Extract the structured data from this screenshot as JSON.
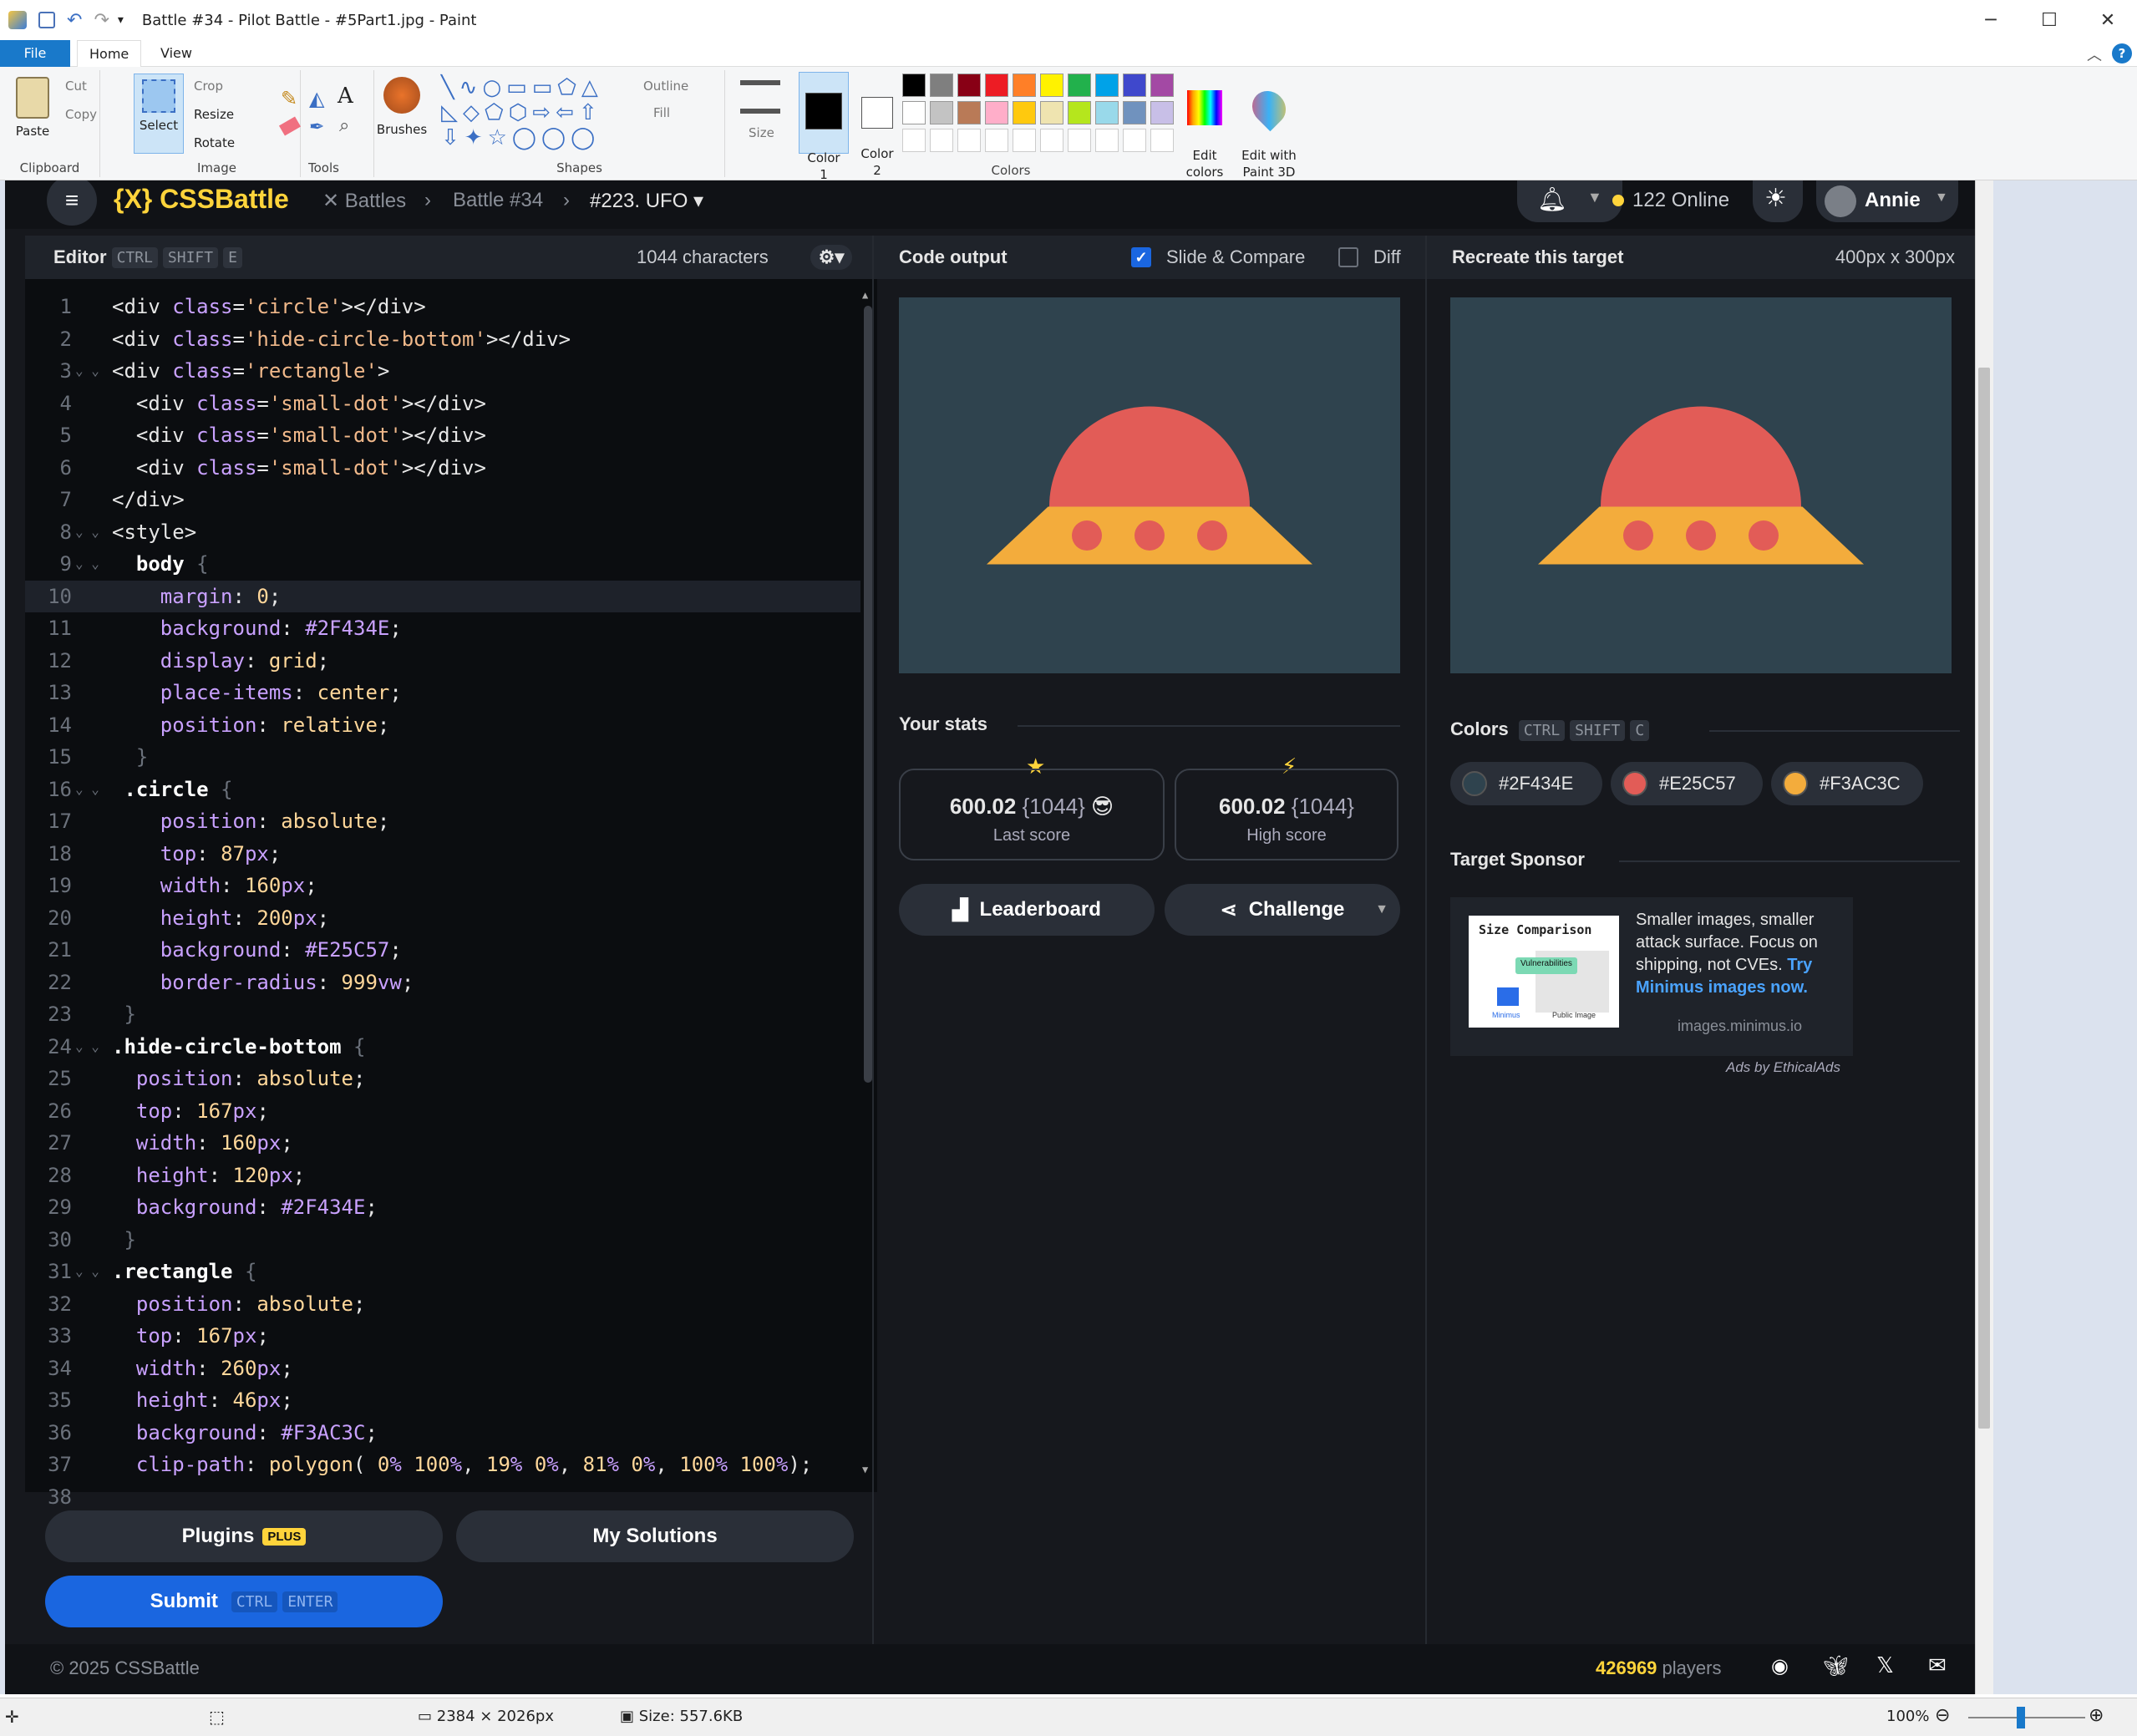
{
  "window": {
    "title": "Battle #34 - Pilot Battle - #5Part1.jpg - Paint",
    "minimize": "─",
    "maximize": "☐",
    "close": "✕"
  },
  "ribbon": {
    "tabs": [
      "File",
      "Home",
      "View"
    ],
    "clipboard": {
      "paste": "Paste",
      "cut": "Cut",
      "copy": "Copy",
      "label": "Clipboard"
    },
    "image": {
      "select": "Select",
      "crop": "Crop",
      "resize": "Resize",
      "rotate": "Rotate",
      "label": "Image"
    },
    "tools": {
      "label": "Tools"
    },
    "brushes": "Brushes",
    "shapes": {
      "outline": "Outline",
      "fill": "Fill",
      "label": "Shapes"
    },
    "size": "Size",
    "color1": "Color\n1",
    "color2": "Color\n2",
    "colors_label": "Colors",
    "edit_colors": "Edit\ncolors",
    "paint3d": "Edit with\nPaint 3D",
    "palette_row1": [
      "#000000",
      "#7f7f7f",
      "#880015",
      "#ed1c24",
      "#ff7f27",
      "#fff200",
      "#22b14c",
      "#00a2e8",
      "#3f48cc",
      "#a349a4"
    ],
    "palette_row2": [
      "#ffffff",
      "#c3c3c3",
      "#b97a57",
      "#ffaec9",
      "#ffc90e",
      "#efe4b0",
      "#b5e61d",
      "#99d9ea",
      "#7092be",
      "#c8bfe7"
    ]
  },
  "status": {
    "dims": "2384 × 2026px",
    "size": "Size: 557.6KB",
    "zoom": "100%"
  },
  "app": {
    "logo": "{X} CSSBattle",
    "crumbs": [
      "Battles",
      "Battle #34",
      "#223. UFO"
    ],
    "online": "122 Online",
    "user": "Annie",
    "editor": {
      "title": "Editor",
      "keys": [
        "CTRL",
        "SHIFT",
        "E"
      ],
      "chars": "1044 characters"
    },
    "output": {
      "title": "Code output",
      "slide": "Slide & Compare",
      "diff": "Diff"
    },
    "target": {
      "title": "Recreate this target",
      "size": "400px x 300px"
    },
    "stats": {
      "title": "Your stats",
      "last_score": "600.02",
      "last_chars": "{1044}",
      "last_label": "Last score",
      "high_score": "600.02",
      "high_chars": "{1044}",
      "high_label": "High score"
    },
    "leaderboard": "Leaderboard",
    "challenge": "Challenge",
    "colors": {
      "title": "Colors",
      "keys": [
        "CTRL",
        "SHIFT",
        "C"
      ],
      "list": [
        "#2F434E",
        "#E25C57",
        "#F3AC3C"
      ]
    },
    "sponsor": {
      "title": "Target Sponsor",
      "img_title": "Size Comparison",
      "img_vuln": "Vulnerabilities",
      "img_left": "Minimus",
      "img_right": "Public Image",
      "text": "Smaller images, smaller attack surface. Focus on shipping, not CVEs.",
      "link": "Try Minimus images now.",
      "domain": "images.minimus.io",
      "ads": "Ads by EthicalAds"
    },
    "plugins": "Plugins",
    "plus": "PLUS",
    "my_solutions": "My Solutions",
    "submit": "Submit",
    "submit_keys": [
      "CTRL",
      "ENTER"
    ],
    "footer": {
      "copyright": "© 2025 CSSBattle",
      "players_num": "426969",
      "players": "players"
    }
  },
  "code_lines": [
    "<div class='circle'></div>",
    "<div class='hide-circle-bottom'></div>",
    "<div class='rectangle'>",
    "  <div class='small-dot'></div>",
    "  <div class='small-dot'></div>",
    "  <div class='small-dot'></div>",
    "</div>",
    "<style>",
    "  body {",
    "    margin: 0;",
    "    background: #2F434E;",
    "    display: grid;",
    "    place-items: center;",
    "    position: relative;",
    "  }",
    " .circle {",
    "    position: absolute;",
    "    top: 87px;",
    "    width: 160px;",
    "    height: 200px;",
    "    background: #E25C57;",
    "    border-radius: 999vw;",
    " }",
    ".hide-circle-bottom {",
    "  position: absolute;",
    "  top: 167px;",
    "  width: 160px;",
    "  height: 120px;",
    "  background: #2F434E;",
    " }",
    ".rectangle {",
    "  position: absolute;",
    "  top: 167px;",
    "  width: 260px;",
    "  height: 46px;",
    "  background: #F3AC3C;",
    "  clip-path: polygon( 0% 100%, 19% 0%, 81% 0%, 100% 100%);",
    ""
  ],
  "line_numbers": [
    "1",
    "2",
    "3",
    "4",
    "5",
    "6",
    "7",
    "8",
    "9",
    "10",
    "11",
    "12",
    "13",
    "14",
    "15",
    "16",
    "17",
    "18",
    "19",
    "20",
    "21",
    "22",
    "23",
    "24",
    "25",
    "26",
    "27",
    "28",
    "29",
    "30",
    "31",
    "32",
    "33",
    "34",
    "35",
    "36",
    "37",
    "38"
  ],
  "ufo_colors": {
    "bg": "#2F434E",
    "dome": "#E25C57",
    "base": "#F3AC3C"
  }
}
